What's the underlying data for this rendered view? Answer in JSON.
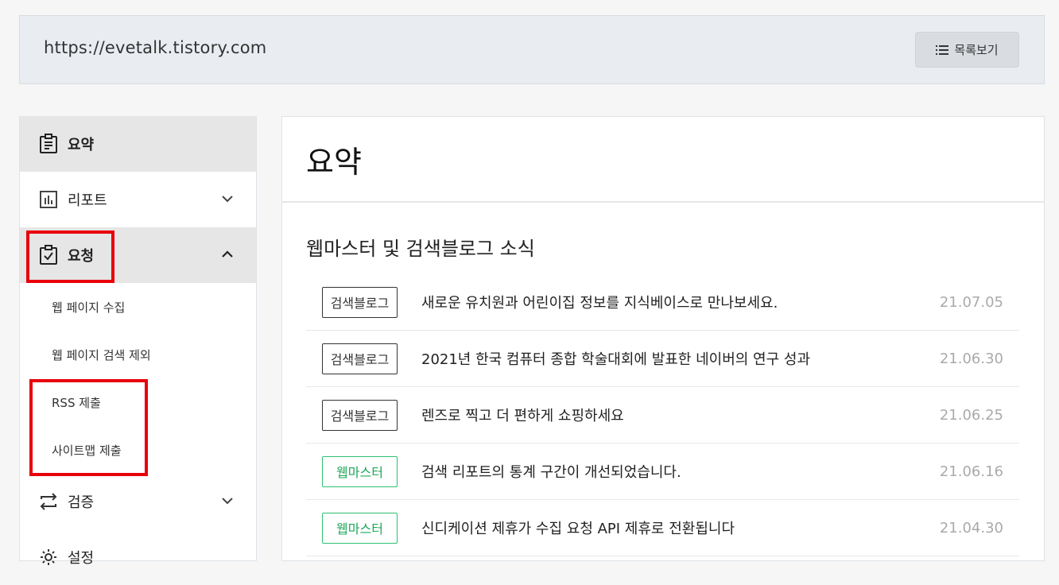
{
  "header": {
    "url": "https://evetalk.tistory.com",
    "list_button_label": "목록보기"
  },
  "sidebar": {
    "items": [
      {
        "label": "요약",
        "icon": "clipboard-list-icon"
      },
      {
        "label": "리포트",
        "icon": "bar-chart-icon"
      },
      {
        "label": "요청",
        "icon": "clipboard-check-icon"
      },
      {
        "label": "검증",
        "icon": "swap-arrows-icon"
      },
      {
        "label": "설정",
        "icon": "gear-icon"
      }
    ],
    "sub_items": [
      "웹 페이지 수집",
      "웹 페이지 검색 제외",
      "RSS 제출",
      "사이트맵 제출"
    ]
  },
  "main": {
    "title": "요약",
    "section_title": "웹마스터 및 검색블로그 소식",
    "news": [
      {
        "badge": "검색블로그",
        "text": "새로운 유치원과 어린이집 정보를 지식베이스로 만나보세요.",
        "date": "21.07.05"
      },
      {
        "badge": "검색블로그",
        "text": "2021년 한국 컴퓨터 종합 학술대회에 발표한 네이버의 연구 성과",
        "date": "21.06.30"
      },
      {
        "badge": "검색블로그",
        "text": "렌즈로 찍고 더 편하게 쇼핑하세요",
        "date": "21.06.25"
      },
      {
        "badge": "웹마스터",
        "text": "검색 리포트의 통계 구간이 개선되었습니다.",
        "date": "21.06.16"
      },
      {
        "badge": "웹마스터",
        "text": "신디케이션 제휴가 수집 요청 API 제휴로 전환됩니다",
        "date": "21.04.30"
      }
    ]
  },
  "colors": {
    "highlight_red": "#e8000b",
    "webmaster_green": "#2fbf71"
  }
}
